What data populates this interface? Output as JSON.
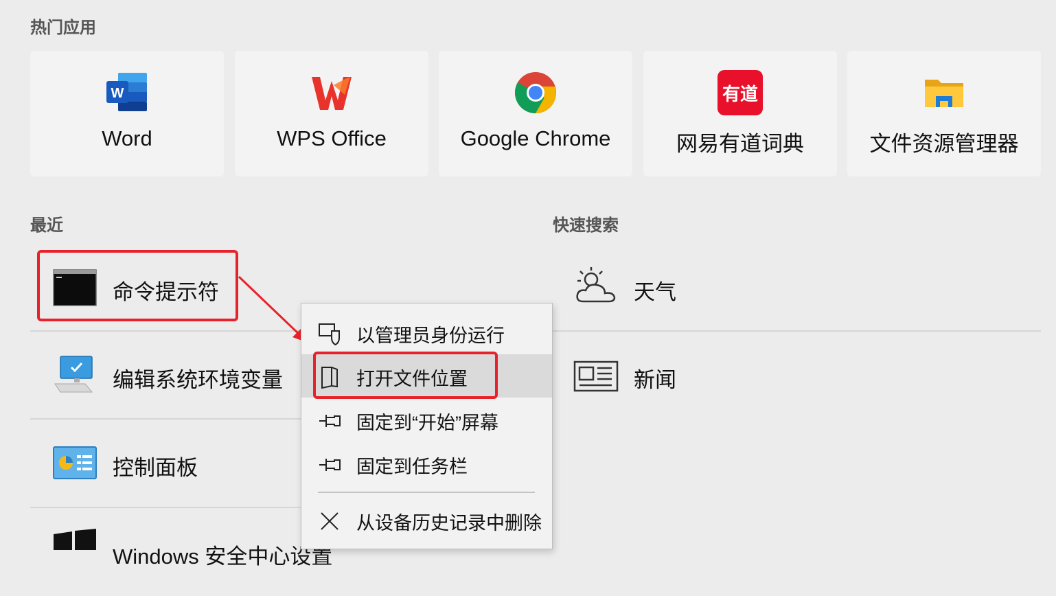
{
  "popular": {
    "title": "热门应用",
    "apps": [
      {
        "label": "Word",
        "icon": "word-icon"
      },
      {
        "label": "WPS Office",
        "icon": "wps-office-icon"
      },
      {
        "label": "Google Chrome",
        "icon": "chrome-icon"
      },
      {
        "label": "网易有道词典",
        "icon": "youdao-icon",
        "icon_text": "有道"
      },
      {
        "label": "文件资源管理器",
        "icon": "file-explorer-icon"
      }
    ]
  },
  "recent": {
    "title": "最近",
    "items": [
      {
        "label": "命令提示符",
        "icon": "command-prompt-icon"
      },
      {
        "label": "编辑系统环境变量",
        "icon": "system-properties-icon"
      },
      {
        "label": "控制面板",
        "icon": "control-panel-icon"
      },
      {
        "label": "Windows 安全中心设置",
        "icon": "windows-logo-icon"
      }
    ]
  },
  "quick_search": {
    "title": "快速搜索",
    "items": [
      {
        "label": "天气",
        "icon": "weather-icon"
      },
      {
        "label": "新闻",
        "icon": "news-icon"
      }
    ]
  },
  "context_menu": {
    "items": [
      {
        "label": "以管理员身份运行",
        "icon": "shield-icon"
      },
      {
        "label": "打开文件位置",
        "icon": "folder-location-icon",
        "highlighted": true
      },
      {
        "label": "固定到“开始”屏幕",
        "icon": "pin-icon"
      },
      {
        "label": "固定到任务栏",
        "icon": "pin-icon"
      },
      {
        "label": "从设备历史记录中删除",
        "icon": "close-icon"
      }
    ]
  },
  "colors": {
    "annotation_red": "#e8222a",
    "background": "#ececec",
    "tile": "#f3f3f3"
  }
}
